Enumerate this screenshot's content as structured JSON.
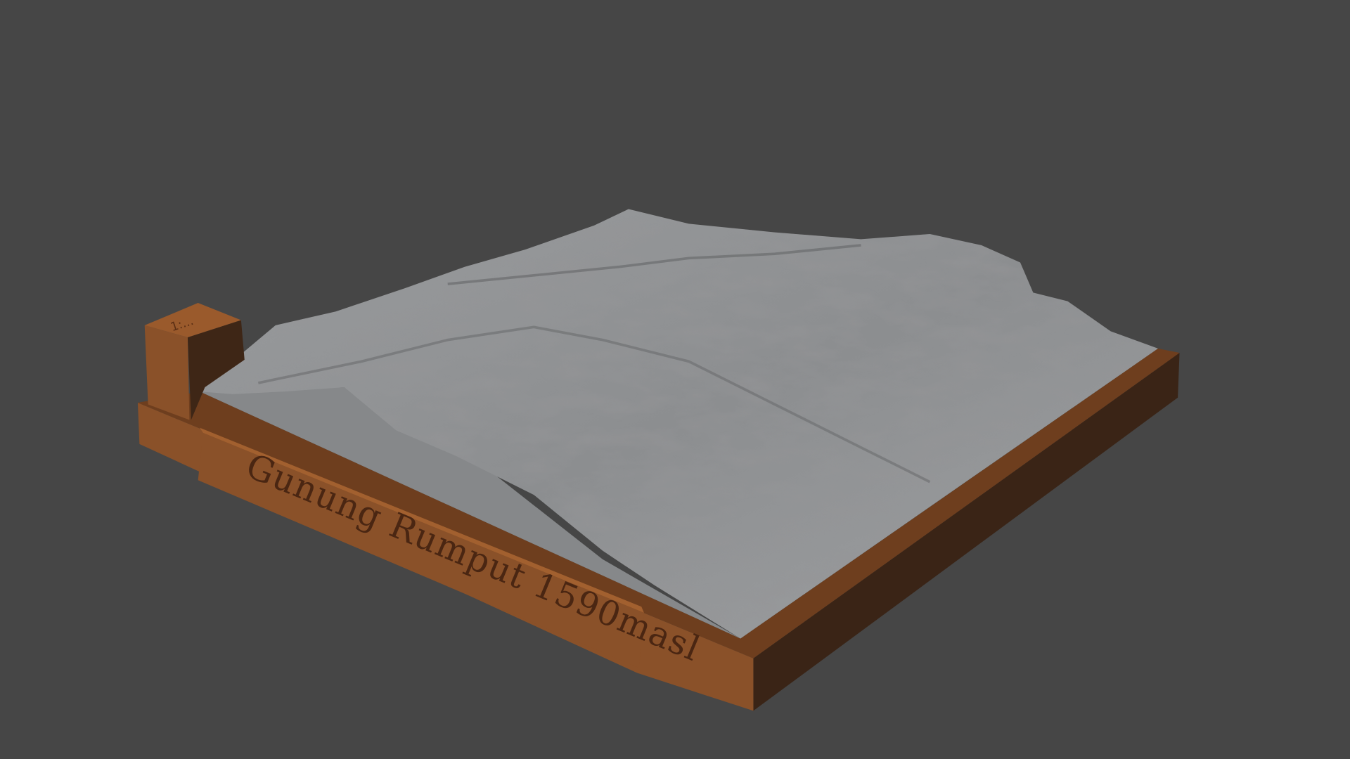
{
  "scene": {
    "background_color": "#464646",
    "plaque_label": "Gunung Rumput 1590masl",
    "corner_block_mark": "1:...",
    "colors": {
      "base_front": "#8a5129",
      "base_side": "#3a2416",
      "base_top": "#7a4522",
      "terrain": "#8f9193",
      "flat_plate": "#86888a"
    }
  }
}
